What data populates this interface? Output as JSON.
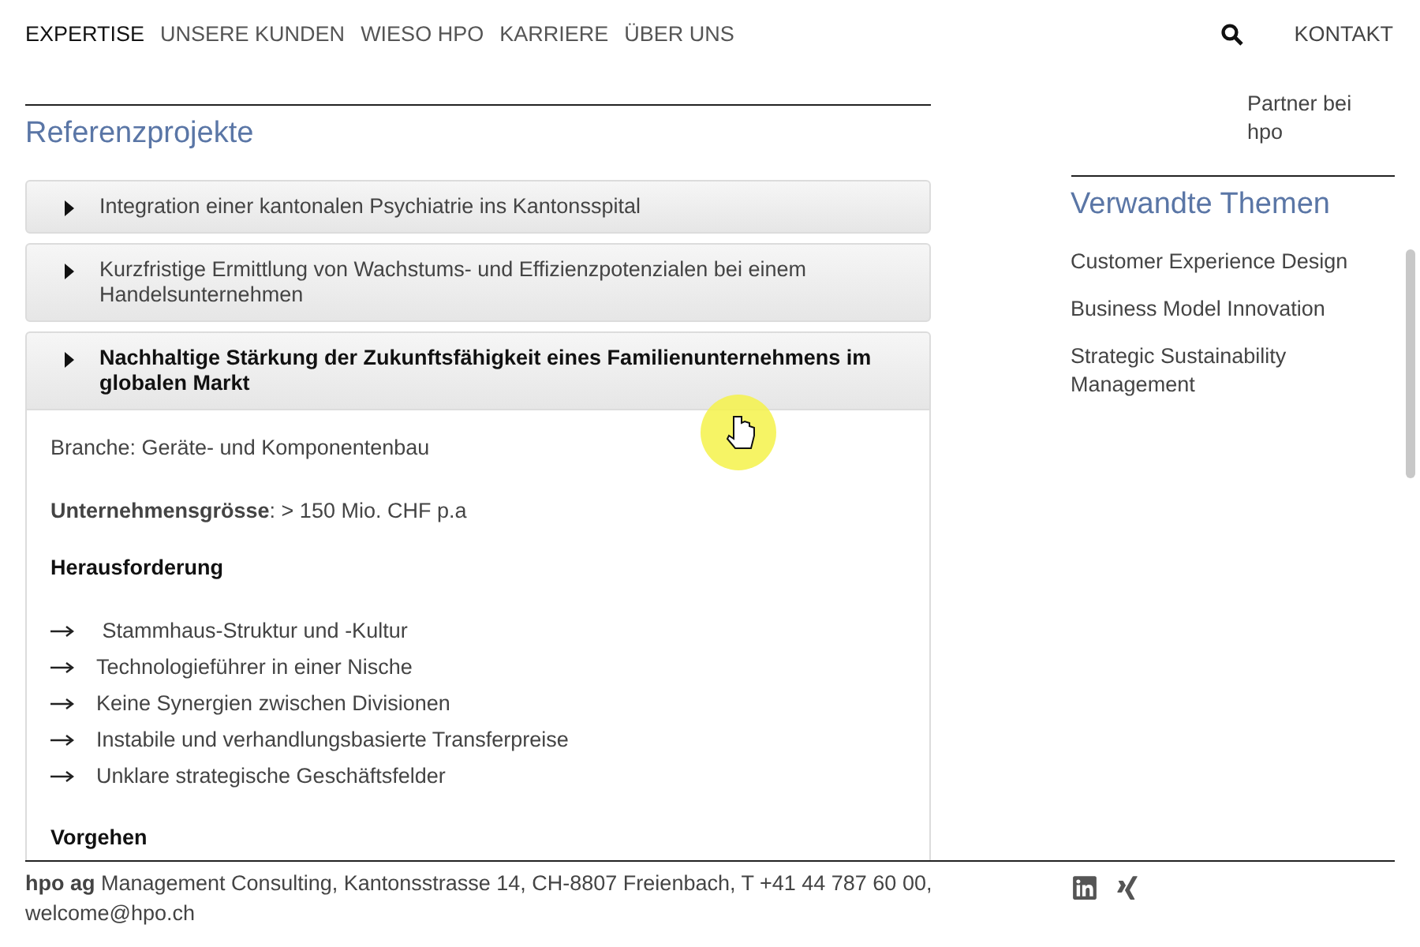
{
  "nav": {
    "items": [
      {
        "label": "EXPERTISE",
        "selected": true
      },
      {
        "label": "UNSERE KUNDEN",
        "selected": false
      },
      {
        "label": "WIESO HPO",
        "selected": false
      },
      {
        "label": "KARRIERE",
        "selected": false
      },
      {
        "label": "ÜBER UNS",
        "selected": false
      }
    ],
    "contact": "KONTAKT"
  },
  "main": {
    "title": "Referenzprojekte",
    "projects": [
      {
        "title": "Integration einer kantonalen Psychiatrie ins Kantonsspital",
        "expanded": false
      },
      {
        "title": "Kurzfristige Ermittlung von Wachstums- und Effizienzpotenzialen bei einem Handelsunternehmen",
        "expanded": false
      },
      {
        "title": "Nachhaltige Stärkung der Zukunftsfähigkeit eines Familienunternehmens im globalen Markt",
        "expanded": true,
        "details": {
          "branche": "Branche: Geräte- und Komponentenbau",
          "size": "**Unternehmensgrösse**: > 150 Mio. CHF p.a",
          "challenge_heading": "Herausforderung",
          "challenges": [
            " Stammhaus-Struktur und -Kultur",
            "Technologieführer in einer Nische",
            "Keine Synergien zwischen Divisionen",
            "Instabile und verhandlungsbasierte Transferpreise",
            "Unklare strategische Geschäftsfelder"
          ],
          "approach_heading": "Vorgehen"
        }
      }
    ]
  },
  "sidebar": {
    "partner": "Partner bei hpo",
    "related_title": "Verwandte Themen",
    "related": [
      "Customer Experience Design",
      "Business Model Innovation",
      "Strategic Sustainability Management"
    ]
  },
  "footer": {
    "address": "**hpo ag** Management Consulting, Kantonsstrasse 14, CH-8807 Freienbach, T +41 44 787 60 00, welcome@hpo.ch"
  }
}
